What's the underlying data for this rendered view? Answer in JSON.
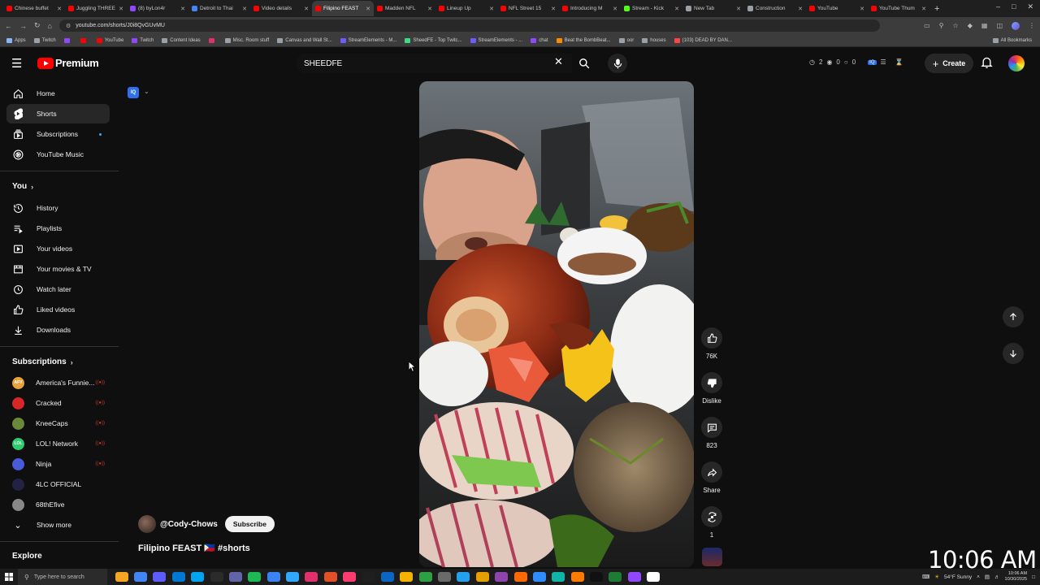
{
  "browser": {
    "tabs": [
      {
        "label": "Chinese buffet",
        "color": "#ff0000"
      },
      {
        "label": "Juggling THREE",
        "color": "#ff0000"
      },
      {
        "label": "(8) byLon4r",
        "color": "#9147ff"
      },
      {
        "label": "Detroit to Thai",
        "color": "#4285f4"
      },
      {
        "label": "Video details",
        "color": "#ff0000"
      },
      {
        "label": "Filipino FEAST",
        "color": "#ff0000",
        "active": true
      },
      {
        "label": "Madden NFL",
        "color": "#ff0000"
      },
      {
        "label": "Lineup Up",
        "color": "#ff0000"
      },
      {
        "label": "NFL Street 15",
        "color": "#ff0000"
      },
      {
        "label": "Introducing M",
        "color": "#ff0000"
      },
      {
        "label": "Stream - Kick",
        "color": "#53fc18"
      },
      {
        "label": "New Tab",
        "color": "#9aa0a6"
      },
      {
        "label": "Construction",
        "color": "#9aa0a6"
      },
      {
        "label": "YouTube",
        "color": "#ff0000"
      },
      {
        "label": "YouTube Thum",
        "color": "#ff0000"
      }
    ],
    "url": "youtube.com/shorts/J0i8QvGUvMU",
    "bookmarks": [
      {
        "label": "Apps",
        "color": "#8ab4f8"
      },
      {
        "label": "Twitch",
        "color": "#9aa0a6"
      },
      {
        "label": "",
        "color": "#9147ff"
      },
      {
        "label": "",
        "color": "#ff0000"
      },
      {
        "label": "YouTube",
        "color": "#ff0000"
      },
      {
        "label": "Twitch",
        "color": "#9147ff"
      },
      {
        "label": "Content Ideas",
        "color": "#9aa0a6"
      },
      {
        "label": "",
        "color": "#e1306c"
      },
      {
        "label": "Misc. Room stuff",
        "color": "#9aa0a6"
      },
      {
        "label": "Canvas and Wall St...",
        "color": "#9aa0a6"
      },
      {
        "label": "StreamElements - M...",
        "color": "#6b5cff"
      },
      {
        "label": "SheedFE - Top Twitc...",
        "color": "#3ddc84"
      },
      {
        "label": "StreamElements - ...",
        "color": "#6b5cff"
      },
      {
        "label": "chat",
        "color": "#9147ff"
      },
      {
        "label": "Beat the BombBeat...",
        "color": "#ff8800"
      },
      {
        "label": "oor",
        "color": "#9aa0a6"
      },
      {
        "label": "houses",
        "color": "#9aa0a6"
      },
      {
        "label": "(103) DEAD BY DAN...",
        "color": "#ff4444"
      }
    ],
    "all_bookmarks": "All Bookmarks"
  },
  "header": {
    "logo_text": "Premium",
    "search_value": "SHEEDFE",
    "ext_counts": [
      "2",
      "0",
      "0"
    ],
    "create_label": "Create"
  },
  "sidebar": {
    "main": [
      {
        "label": "Home",
        "icon": "home-icon"
      },
      {
        "label": "Shorts",
        "icon": "shorts-icon",
        "active": true
      },
      {
        "label": "Subscriptions",
        "icon": "subscriptions-icon"
      },
      {
        "label": "YouTube Music",
        "icon": "youtube-music-icon"
      }
    ],
    "you_label": "You",
    "you": [
      {
        "label": "History",
        "icon": "history-icon"
      },
      {
        "label": "Playlists",
        "icon": "playlists-icon"
      },
      {
        "label": "Your videos",
        "icon": "your-videos-icon"
      },
      {
        "label": "Your movies & TV",
        "icon": "movies-icon"
      },
      {
        "label": "Watch later",
        "icon": "watch-later-icon"
      },
      {
        "label": "Liked videos",
        "icon": "liked-icon"
      },
      {
        "label": "Downloads",
        "icon": "downloads-icon"
      }
    ],
    "subs_label": "Subscriptions",
    "subs": [
      {
        "label": "America's Funnie...",
        "color": "#e8a33a",
        "abbr": "AFV",
        "live": true
      },
      {
        "label": "Cracked",
        "color": "#d82727",
        "abbr": "",
        "live": true
      },
      {
        "label": "KneeCaps",
        "color": "#6a8a3a",
        "abbr": "",
        "live": true
      },
      {
        "label": "LOL! Network",
        "color": "#2ecc71",
        "abbr": "LOL",
        "live": true
      },
      {
        "label": "Ninja",
        "color": "#4a5ad8",
        "abbr": "",
        "live": true
      },
      {
        "label": "4LC OFFICIAL",
        "color": "#222244",
        "abbr": "",
        "live": false
      },
      {
        "label": "68thEfive",
        "color": "#888888",
        "abbr": "",
        "live": false
      }
    ],
    "show_more": "Show more",
    "explore_label": "Explore"
  },
  "short": {
    "channel": "@Cody-Chows",
    "subscribe": "Subscribe",
    "title": "Filipino FEAST 🇵🇭 #shorts",
    "likes": "76K",
    "dislike": "Dislike",
    "comments": "823",
    "share": "Share",
    "remix": "1"
  },
  "overlay": {
    "clock": "10:06 AM"
  },
  "taskbar": {
    "search_placeholder": "Type here to search",
    "weather": "54°F  Sunny",
    "time": "10:06 AM",
    "date": "10/30/2025",
    "apps": [
      "#f5a623",
      "#4285f4",
      "#5e5cff",
      "#0078d4",
      "#00a4ef",
      "#2b2b2b",
      "#6264a7",
      "#1db954",
      "#3b82f6",
      "#31a8ff",
      "#e1306c",
      "#e34f26",
      "#ff3c6f",
      "#1f1f1f",
      "#0a66c2",
      "#f3b300",
      "#2ea043",
      "#6a6a6a",
      "#24a0ed",
      "#e5a000",
      "#8e44ad",
      "#ff6a00",
      "#2f8bff",
      "#0fb5a6",
      "#ff7a00",
      "#111111",
      "#1e7b34",
      "#9146ff",
      "#ffffff"
    ]
  }
}
